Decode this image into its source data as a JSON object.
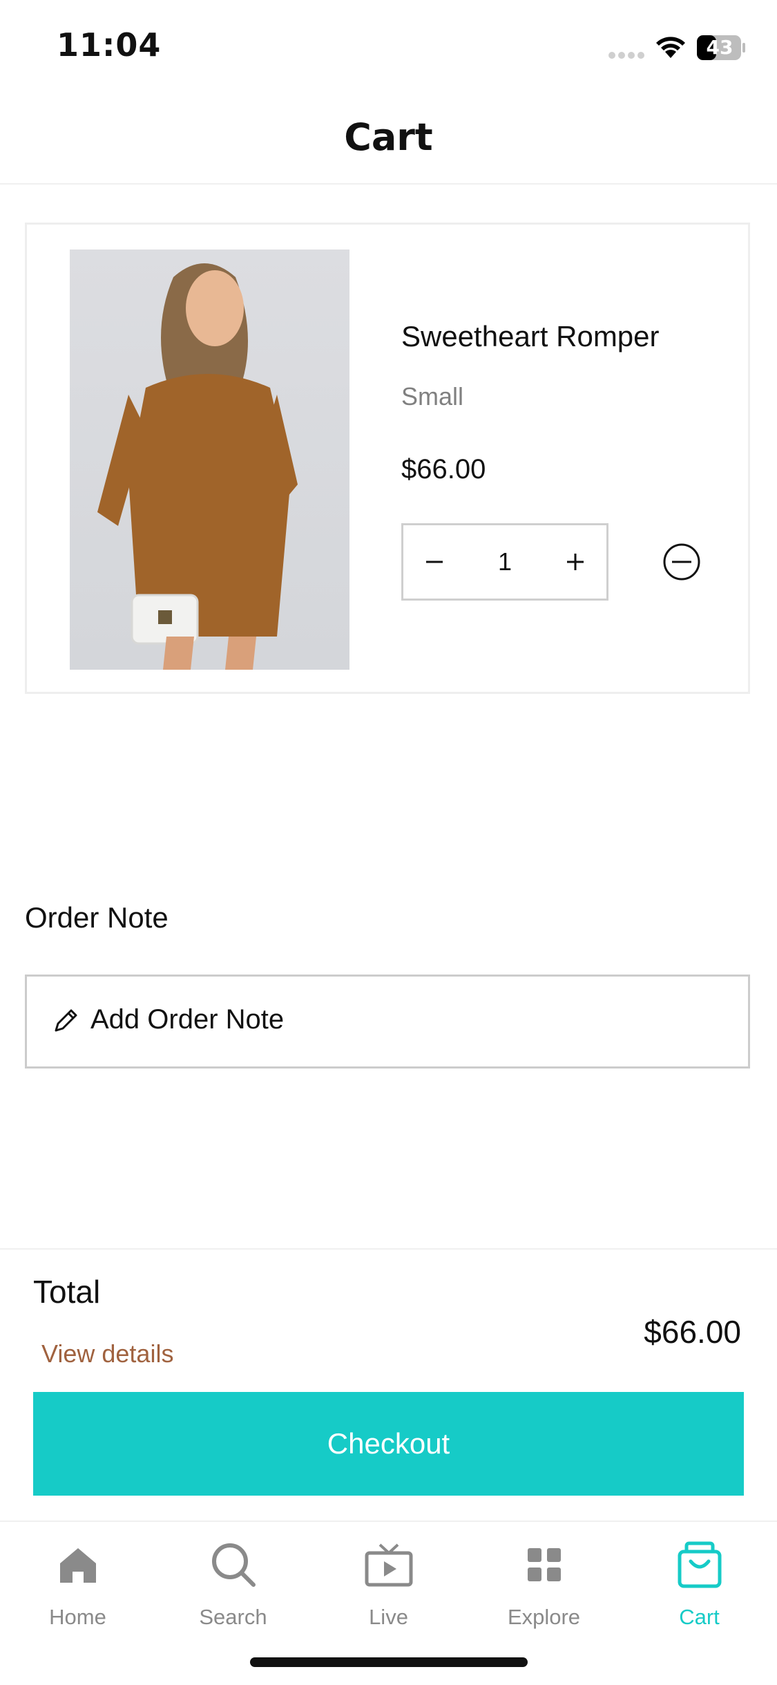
{
  "status_bar": {
    "time": "11:04",
    "battery": "43"
  },
  "header": {
    "title": "Cart"
  },
  "cart": {
    "items": [
      {
        "name": "Sweetheart Romper",
        "variant": "Small",
        "price": "$66.00",
        "quantity": "1"
      }
    ]
  },
  "order_note": {
    "label": "Order Note",
    "placeholder": "Add Order Note"
  },
  "totals": {
    "label": "Total",
    "value": "$66.00",
    "view_details": "View details",
    "checkout_label": "Checkout"
  },
  "tab_bar": {
    "tabs": [
      {
        "label": "Home",
        "icon": "home-icon"
      },
      {
        "label": "Search",
        "icon": "search-icon"
      },
      {
        "label": "Live",
        "icon": "tv-icon"
      },
      {
        "label": "Explore",
        "icon": "grid-icon"
      },
      {
        "label": "Cart",
        "icon": "shopping-bag-icon",
        "active": true
      }
    ]
  },
  "colors": {
    "accent": "#16cbc7",
    "link": "#a0623f",
    "muted": "#8a8a8a"
  }
}
